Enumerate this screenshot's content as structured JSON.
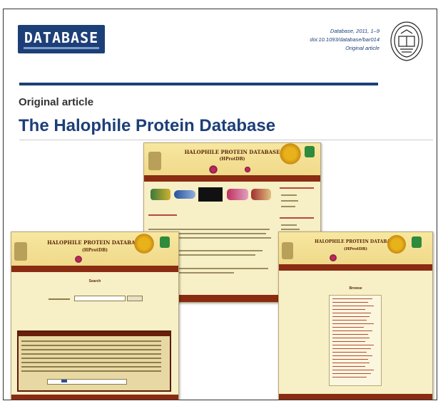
{
  "journal": {
    "logo_text": "DATABASE",
    "citation": "Database, 2011, 1–9",
    "doi": "doi:10.1093/database/bar014",
    "article_type": "Original article"
  },
  "section_label": "Original article",
  "title": "The Halophile Protein Database",
  "screenshots": {
    "top": {
      "banner_title": "HALOPHILE PROTEIN DATABASE",
      "banner_sub": "(HProtDB)"
    },
    "left": {
      "banner_title": "HALOPHILE PROTEIN DATABASE",
      "banner_sub": "(HProtDB)",
      "page_heading": "Search"
    },
    "right": {
      "banner_title": "HALOPHILE PROTEIN DATABASE",
      "banner_sub": "(HProtDB)",
      "page_heading": "Browse"
    }
  },
  "colors": {
    "journal_blue": "#1d3f78",
    "site_maroon": "#8a2b12",
    "site_cream": "#f7efc6"
  },
  "icons": [
    "university-seal-icon",
    "sun-icon",
    "flower-icon",
    "emblem-icon"
  ]
}
